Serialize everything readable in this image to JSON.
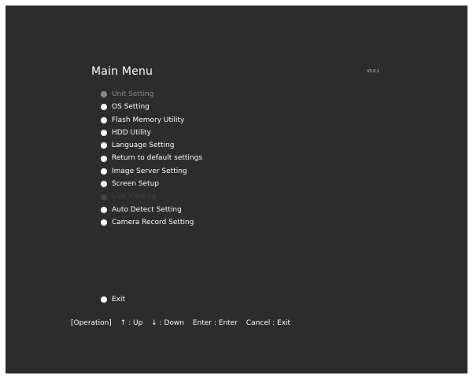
{
  "title": "Main Menu",
  "version": "V3.0.1",
  "menu": {
    "items": [
      {
        "label": "Unit Setting",
        "state": "selected"
      },
      {
        "label": "OS Setting",
        "state": "normal"
      },
      {
        "label": "Flash Memory Utility",
        "state": "normal"
      },
      {
        "label": "HDD Utility",
        "state": "normal"
      },
      {
        "label": "Language Setting",
        "state": "normal"
      },
      {
        "label": "Return to default settings",
        "state": "normal"
      },
      {
        "label": "Image Server Setting",
        "state": "normal"
      },
      {
        "label": "Screen Setup",
        "state": "normal"
      },
      {
        "label": "Live Viewing",
        "state": "disabled"
      },
      {
        "label": "Auto Detect Setting",
        "state": "normal"
      },
      {
        "label": "Camera Record Setting",
        "state": "normal"
      }
    ],
    "exit_label": "Exit"
  },
  "help": {
    "operation": "[Operation]",
    "up": "↑ : Up",
    "down": "↓ : Down",
    "enter": "Enter : Enter",
    "cancel": "Cancel : Exit"
  },
  "colors": {
    "background": "#2c2c2c",
    "text": "#ffffff",
    "selected": "#8c8c8c",
    "disabled": "#444444"
  }
}
